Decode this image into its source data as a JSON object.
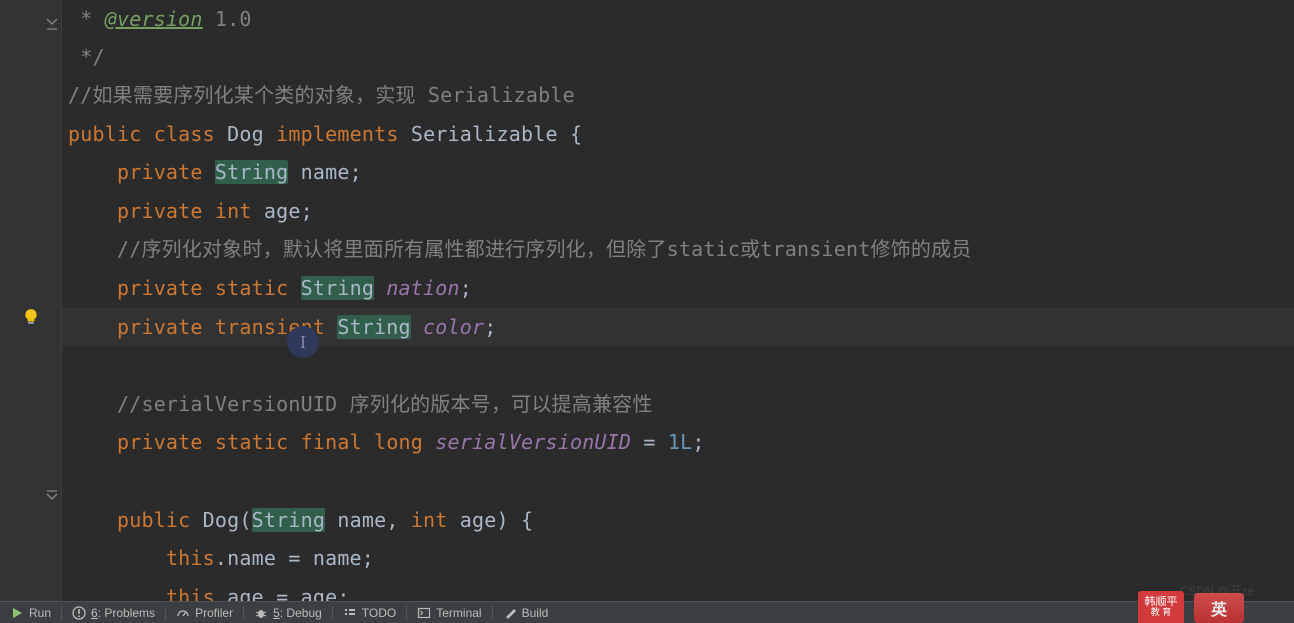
{
  "code": {
    "l0_tag": "@version",
    "l0_rest": " 1.0",
    "l1": " */",
    "l2": "//如果需要序列化某个类的对象，实现 Serializable",
    "l3_public": "public",
    "l3_class": "class",
    "l3_name": "Dog",
    "l3_impl": "implements",
    "l3_iface": "Serializable",
    "l3_brace": " {",
    "l4_priv": "private",
    "l4_type": "String",
    "l4_name": "name",
    "l5_priv": "private",
    "l5_type": "int",
    "l5_name": "age",
    "l6": "//序列化对象时，默认将里面所有属性都进行序列化，但除了static或transient修饰的成员",
    "l7_priv": "private",
    "l7_static": "static",
    "l7_type": "String",
    "l7_name": "nation",
    "l8_priv": "private",
    "l8_trans": "transient",
    "l8_type": "String",
    "l8_name": "color",
    "l10": "//serialVersionUID 序列化的版本号，可以提高兼容性",
    "l11_priv": "private",
    "l11_static": "static",
    "l11_final": "final",
    "l11_type": "long",
    "l11_name": "serialVersionUID",
    "l11_val": "1L",
    "l13_public": "public",
    "l13_ctor": "Dog",
    "l13_pt1": "String",
    "l13_pn1": "name",
    "l13_pt2": "int",
    "l13_pn2": "age",
    "l13_brace": " {",
    "l14_this": "this",
    "l14_dot": ".name = name;",
    "l15_this": "this",
    "l15_dot": ".age = age;"
  },
  "cursor_glyph": "I",
  "bottom": {
    "run": "Run",
    "problems_u": "6",
    "problems": ": Problems",
    "profiler": "Profiler",
    "debug_u": "5",
    "debug": ": Debug",
    "todo": "TODO",
    "terminal": "Terminal",
    "build": "Build"
  },
  "logo_text": "韩顺平",
  "logo_sub": "教 育",
  "ime_text": "英",
  "watermark": "CSDN @万ze"
}
